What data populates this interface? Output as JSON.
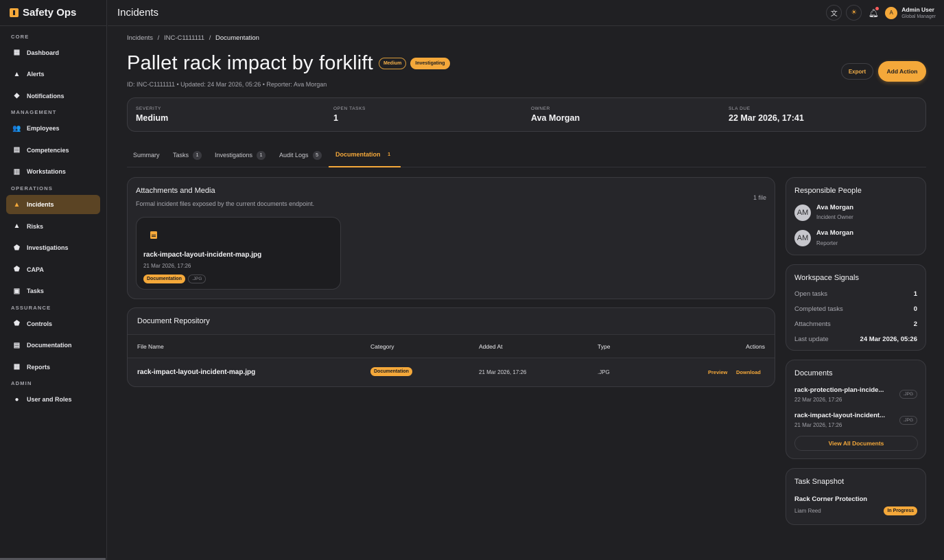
{
  "app": {
    "name": "Safety Ops"
  },
  "sidebar": {
    "sections": [
      {
        "label": "CORE",
        "items": [
          {
            "label": "Dashboard",
            "icon": "grid-icon"
          },
          {
            "label": "Alerts",
            "icon": "warning-icon"
          },
          {
            "label": "Notifications",
            "icon": "bell-icon"
          }
        ]
      },
      {
        "label": "MANAGEMENT",
        "items": [
          {
            "label": "Employees",
            "icon": "people-icon"
          },
          {
            "label": "Competencies",
            "icon": "building-icon"
          },
          {
            "label": "Workstations",
            "icon": "factory-icon"
          }
        ]
      },
      {
        "label": "OPERATIONS",
        "items": [
          {
            "label": "Incidents",
            "icon": "warning-icon",
            "active": true
          },
          {
            "label": "Risks",
            "icon": "warning-icon"
          },
          {
            "label": "Investigations",
            "icon": "shield-icon"
          },
          {
            "label": "CAPA",
            "icon": "shield-check-icon"
          },
          {
            "label": "Tasks",
            "icon": "clipboard-icon"
          }
        ]
      },
      {
        "label": "ASSURANCE",
        "items": [
          {
            "label": "Controls",
            "icon": "shield-icon"
          },
          {
            "label": "Documentation",
            "icon": "document-icon"
          },
          {
            "label": "Reports",
            "icon": "chart-icon"
          }
        ]
      },
      {
        "label": "ADMIN",
        "items": [
          {
            "label": "User and Roles",
            "icon": "user-gear-icon"
          }
        ]
      }
    ]
  },
  "topbar": {
    "title": "Incidents",
    "user": {
      "initial": "A",
      "name": "Admin User",
      "role": "Global Manager"
    }
  },
  "breadcrumb": {
    "part1": "Incidents",
    "sep": "/",
    "part2": "INC-C1111111",
    "current": "Documentation"
  },
  "incident": {
    "title": "Pallet rack impact by forklift",
    "severity_badge": "Medium",
    "status_badge": "Investigating",
    "meta": "ID: INC-C1111111 • Updated: 24 Mar 2026, 05:26 • Reporter: Ava Morgan",
    "export_label": "Export",
    "add_action_label": "Add Action"
  },
  "stats": [
    {
      "label": "SEVERITY",
      "value": "Medium"
    },
    {
      "label": "OPEN TASKS",
      "value": "1"
    },
    {
      "label": "OWNER",
      "value": "Ava Morgan"
    },
    {
      "label": "SLA DUE",
      "value": "22 Mar 2026, 17:41"
    }
  ],
  "tabs": [
    {
      "label": "Summary",
      "count": ""
    },
    {
      "label": "Tasks",
      "count": "1"
    },
    {
      "label": "Investigations",
      "count": "1"
    },
    {
      "label": "Audit Logs",
      "count": "5"
    },
    {
      "label": "Documentation",
      "count": "1",
      "active": true
    }
  ],
  "attachments": {
    "title": "Attachments and Media",
    "subtitle": "Formal incident files exposed by the current documents endpoint.",
    "count": "1 file",
    "file": {
      "name": "rack-impact-layout-incident-map.jpg",
      "date": "21 Mar 2026, 17:26",
      "category": "Documentation",
      "type": ".JPG"
    }
  },
  "repository": {
    "title": "Document Repository",
    "headers": {
      "name": "File Name",
      "category": "Category",
      "added": "Added At",
      "type": "Type",
      "actions": "Actions"
    },
    "rows": [
      {
        "name": "rack-impact-layout-incident-map.jpg",
        "category": "Documentation",
        "added": "21 Mar 2026, 17:26",
        "type": ".JPG",
        "preview": "Preview",
        "download": "Download"
      }
    ]
  },
  "responsible": {
    "title": "Responsible People",
    "people": [
      {
        "initials": "AM",
        "name": "Ava Morgan",
        "role": "Incident Owner"
      },
      {
        "initials": "AM",
        "name": "Ava Morgan",
        "role": "Reporter"
      }
    ]
  },
  "signals": {
    "title": "Workspace Signals",
    "rows": [
      {
        "label": "Open tasks",
        "value": "1"
      },
      {
        "label": "Completed tasks",
        "value": "0"
      },
      {
        "label": "Attachments",
        "value": "2"
      },
      {
        "label": "Last update",
        "value": "24 Mar 2026, 05:26"
      }
    ]
  },
  "documents": {
    "title": "Documents",
    "items": [
      {
        "name": "rack-protection-plan-incide...",
        "date": "22 Mar 2026, 17:26",
        "type": ".JPG"
      },
      {
        "name": "rack-impact-layout-incident...",
        "date": "21 Mar 2026, 17:26",
        "type": ".JPG"
      }
    ],
    "view_all": "View All Documents"
  },
  "task_snapshot": {
    "title": "Task Snapshot",
    "task": "Rack Corner Protection",
    "assignee": "Liam Reed",
    "status": "In Progress"
  },
  "colors": {
    "accent": "#f4a83a",
    "bg": "#202023",
    "card": "#26262a"
  }
}
